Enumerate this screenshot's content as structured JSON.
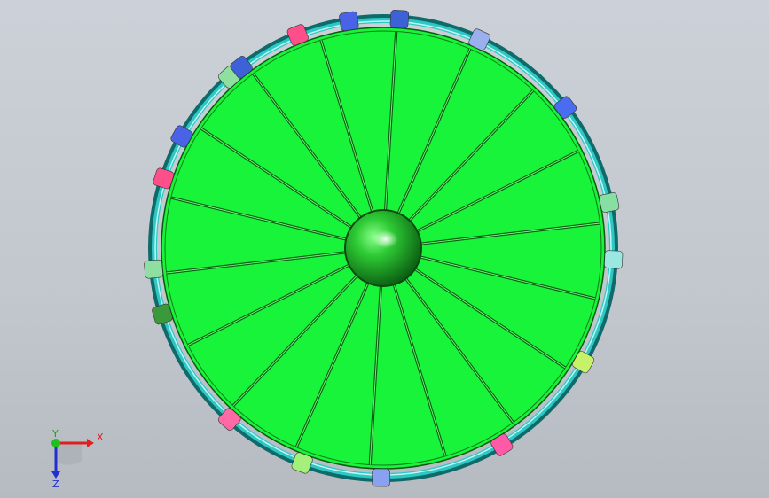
{
  "viewport": {
    "background_top": "#ccd1d8",
    "background_bottom": "#b6bbc1"
  },
  "model": {
    "panel_count": 18,
    "panel_color": "#18f43a",
    "panel_edge_color": "#0a5a12",
    "rim_color": "#2ec8c4",
    "hub_color": "#1fbf2a",
    "marker_colors": [
      "#8fe0a0",
      "#ff4f8a",
      "#4a63e6",
      "#3d62d8",
      "#9ab0ee",
      "#4a6cf0",
      "#86e0a4",
      "#9be8e0",
      "#c6f26a",
      "#ff5aa8",
      "#8aa0f0",
      "#a4f07a",
      "#ff6aa6",
      "#3a9a3a"
    ]
  },
  "triad": {
    "x_label": "X",
    "y_label": "Y",
    "z_label": "Z",
    "x_color": "#e02020",
    "y_color": "#20c020",
    "z_color": "#2030d0"
  }
}
